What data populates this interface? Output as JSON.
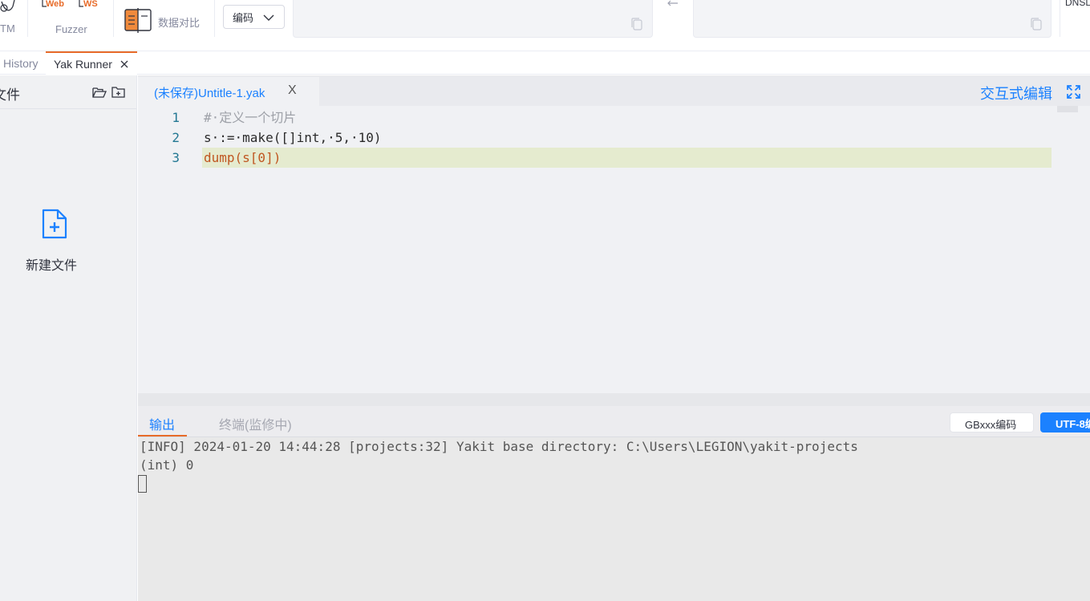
{
  "toolbar": {
    "mitm_label": "TM",
    "web_label": "Web",
    "ws_label": "WS",
    "fuzzer_label": "Fuzzer",
    "compare_label": "数据对比",
    "encode_select_value": "编码"
  },
  "page_tabs": {
    "history_label": "History",
    "yak_runner_label": "Yak Runner",
    "top_right_label": "DNSL"
  },
  "sidebar": {
    "title": "文件",
    "new_file_label": "新建文件"
  },
  "editor": {
    "file_tab_label": "(未保存)Untitle-1.yak",
    "close_glyph": "X",
    "interactive_edit_label": "交互式编辑",
    "lines": [
      {
        "num": "1",
        "text": "#·定义一个切片"
      },
      {
        "num": "2",
        "text": "s·:=·make([]int,·5,·10)"
      },
      {
        "num": "3",
        "text": "dump(s[0])"
      }
    ]
  },
  "output_panel": {
    "tab_output": "输出",
    "tab_terminal": "终端(监修中)",
    "gbk_button": "GBxxx编码",
    "utf8_button": "UTF-8编",
    "lines": [
      "[INFO] 2024-01-20 14:44:28 [projects:32] Yakit base directory: C:\\Users\\LEGION\\yakit-projects",
      "(int) 0"
    ]
  },
  "colors": {
    "accent": "#1b81ff",
    "orange": "#e76b29",
    "line_number": "#237893",
    "highlight": "#e5ebcf"
  }
}
